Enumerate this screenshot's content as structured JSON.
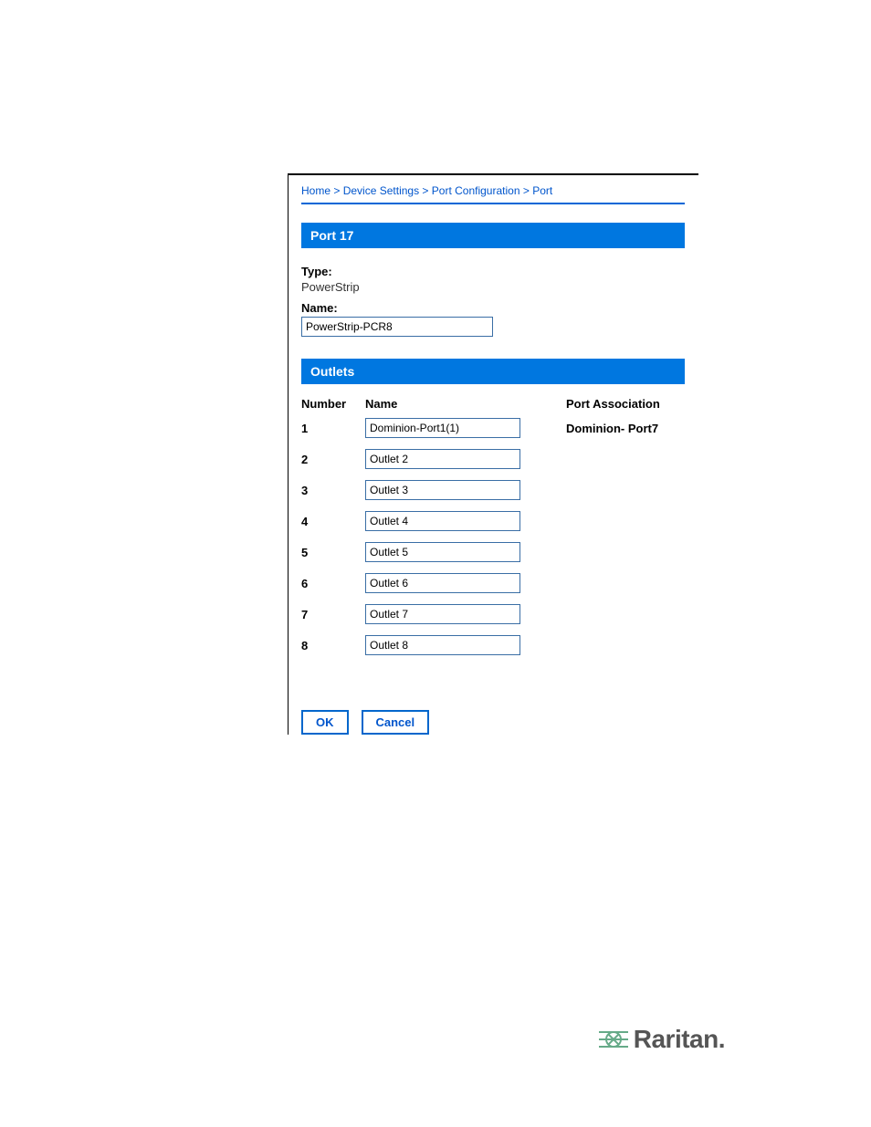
{
  "breadcrumb": {
    "items": [
      "Home",
      "Device Settings",
      "Port Configuration",
      "Port"
    ]
  },
  "port_header": "Port 17",
  "type_label": "Type:",
  "type_value": "PowerStrip",
  "name_label": "Name:",
  "name_value": "PowerStrip-PCR8",
  "outlets_header": "Outlets",
  "columns": {
    "number": "Number",
    "name": "Name",
    "assoc": "Port Association"
  },
  "outlets": [
    {
      "num": "1",
      "name": "Dominion-Port1(1)",
      "assoc": "Dominion- Port7"
    },
    {
      "num": "2",
      "name": "Outlet 2",
      "assoc": ""
    },
    {
      "num": "3",
      "name": "Outlet 3",
      "assoc": ""
    },
    {
      "num": "4",
      "name": "Outlet 4",
      "assoc": ""
    },
    {
      "num": "5",
      "name": "Outlet 5",
      "assoc": ""
    },
    {
      "num": "6",
      "name": "Outlet 6",
      "assoc": ""
    },
    {
      "num": "7",
      "name": "Outlet 7",
      "assoc": ""
    },
    {
      "num": "8",
      "name": "Outlet 8",
      "assoc": ""
    }
  ],
  "buttons": {
    "ok": "OK",
    "cancel": "Cancel"
  },
  "brand": "Raritan."
}
